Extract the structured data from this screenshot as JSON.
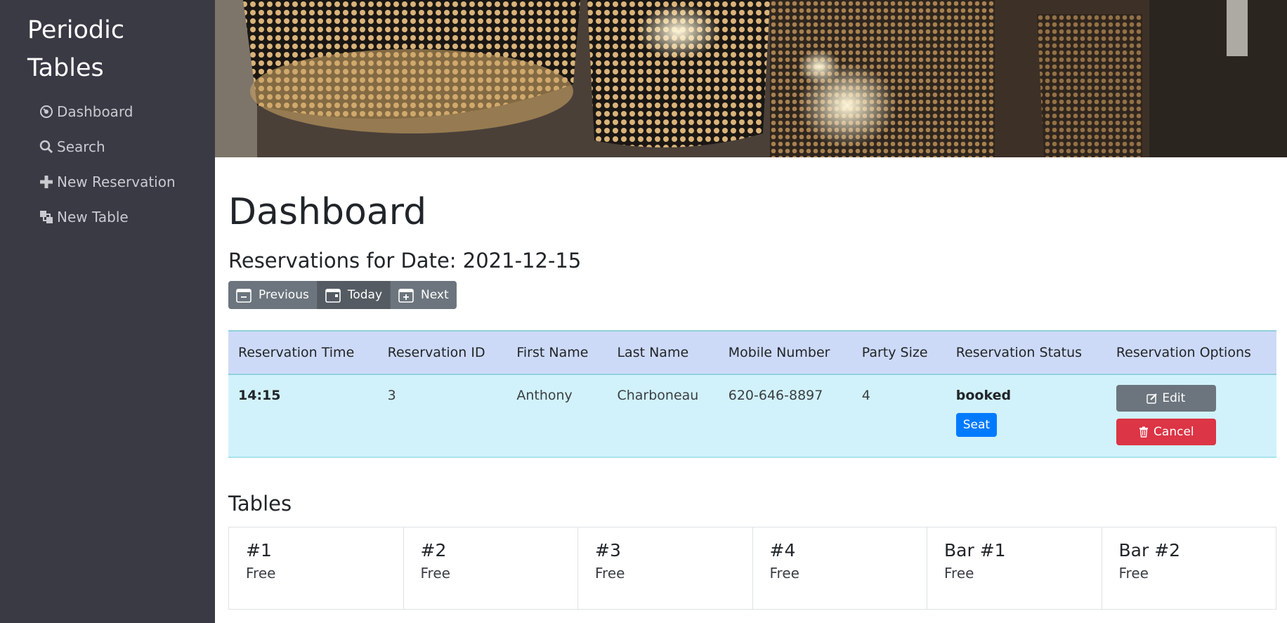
{
  "app": {
    "title": "Periodic Tables"
  },
  "sidebar": {
    "items": [
      {
        "label": "Dashboard",
        "icon": "dashboard-icon"
      },
      {
        "label": "Search",
        "icon": "search-icon"
      },
      {
        "label": "New Reservation",
        "icon": "plus-icon"
      },
      {
        "label": "New Table",
        "icon": "layers-icon"
      }
    ]
  },
  "hero": {
    "description_icon": "pendant-lamps-photo"
  },
  "main": {
    "title": "Dashboard",
    "reservations_heading": "Reservations for Date: 2021-12-15",
    "date_nav": {
      "previous": "Previous",
      "today": "Today",
      "next": "Next"
    },
    "reservations_table": {
      "headers": [
        "Reservation Time",
        "Reservation ID",
        "First Name",
        "Last Name",
        "Mobile Number",
        "Party Size",
        "Reservation Status",
        "Reservation Options"
      ],
      "rows": [
        {
          "time": "14:15",
          "id": "3",
          "first_name": "Anthony",
          "last_name": "Charboneau",
          "mobile": "620-646-8897",
          "party_size": "4",
          "status": "booked",
          "seat_label": "Seat",
          "edit_label": "Edit",
          "cancel_label": "Cancel"
        }
      ]
    },
    "tables_heading": "Tables",
    "tables": [
      {
        "name": "#1",
        "status": "Free"
      },
      {
        "name": "#2",
        "status": "Free"
      },
      {
        "name": "#3",
        "status": "Free"
      },
      {
        "name": "#4",
        "status": "Free"
      },
      {
        "name": "Bar #1",
        "status": "Free"
      },
      {
        "name": "Bar #2",
        "status": "Free"
      }
    ]
  },
  "colors": {
    "sidebar_bg": "#3a3a45",
    "primary": "#007bff",
    "secondary": "#6c757d",
    "danger": "#dc3545",
    "table_header_bg": "#cddaf7",
    "table_row_bg": "#d1f2fa"
  }
}
